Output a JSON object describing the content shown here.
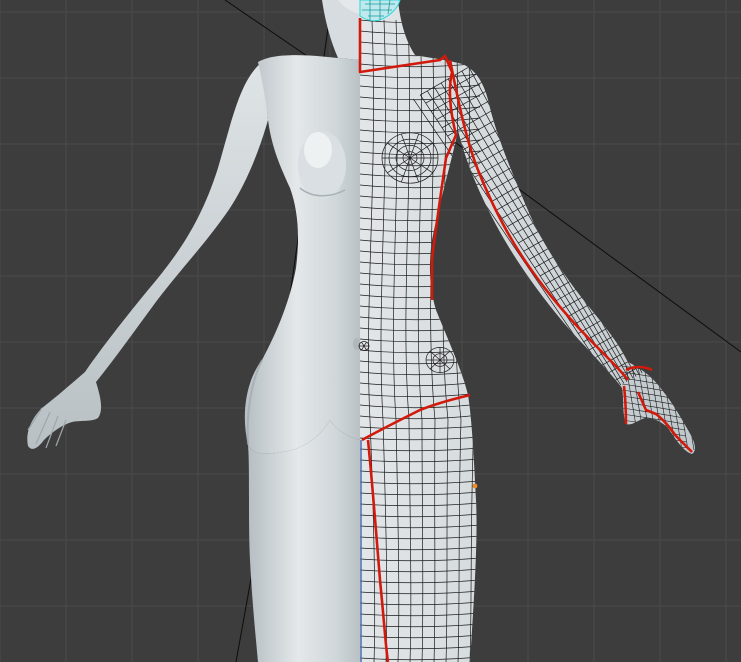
{
  "viewport": {
    "background_color": "#3d3d3d",
    "grid_color": "#4a4a4a",
    "grid_major_color": "#474747",
    "axis_z_color": "#4a6fb5",
    "seam_color": "#d21a0c",
    "wire_color": "#1a1a1a",
    "selected_vertex_color": "#f08a24",
    "helper_line_color": "#0d0d0d"
  },
  "model": {
    "skin_color": "#c9d0d4",
    "skin_light": "#e6eaec",
    "skin_shadow": "#9aa3a8",
    "head_wire_color": "#2fd3d8"
  }
}
